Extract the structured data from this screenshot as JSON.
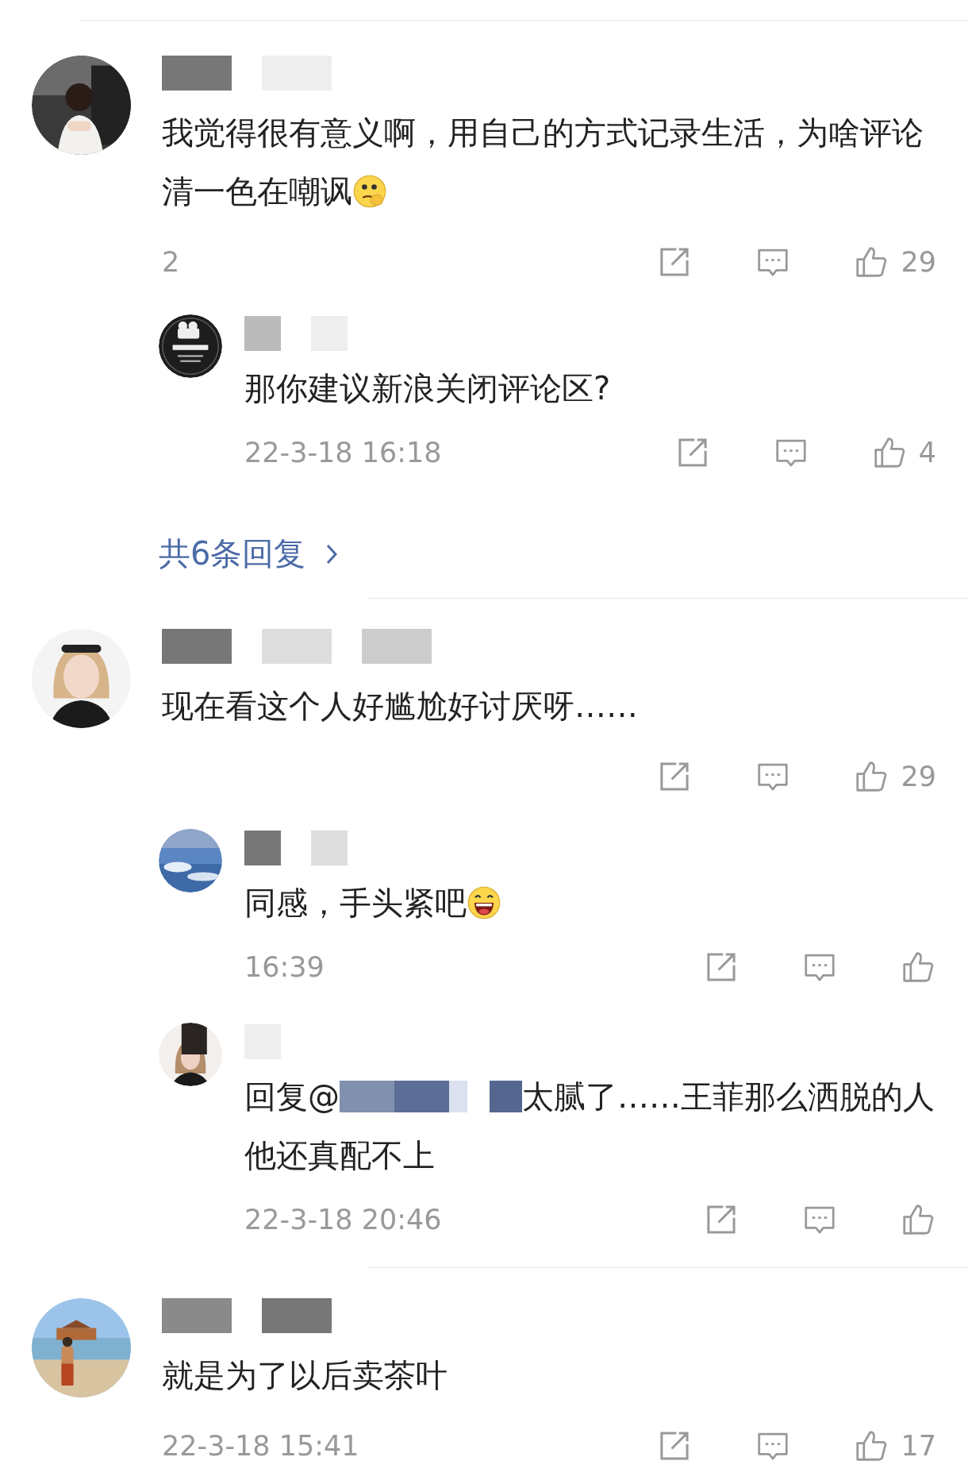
{
  "comments": [
    {
      "text": "我觉得很有意义啊，用自己的方式记录生活，为啥评论清一色在嘲讽",
      "emoji": {
        "kind": "thinking"
      },
      "meta": "2",
      "likes": "29",
      "replies": [
        {
          "text": "那你建议新浪关闭评论区?",
          "time": "22-3-18 16:18",
          "likes": "4"
        }
      ],
      "more_replies": "共6条回复"
    },
    {
      "text": "现在看这个人好尴尬好讨厌呀……",
      "likes": "29",
      "replies": [
        {
          "text": "同感，手头紧吧",
          "emoji": {
            "kind": "grin"
          },
          "time": "16:39"
        },
        {
          "prefix": "回复@",
          "text": "太腻了……王菲那么洒脱的人他还真配不上",
          "time": "22-3-18 20:46"
        }
      ]
    },
    {
      "text": "就是为了以后卖茶叶",
      "time": "22-3-18 15:41",
      "likes": "17"
    }
  ]
}
